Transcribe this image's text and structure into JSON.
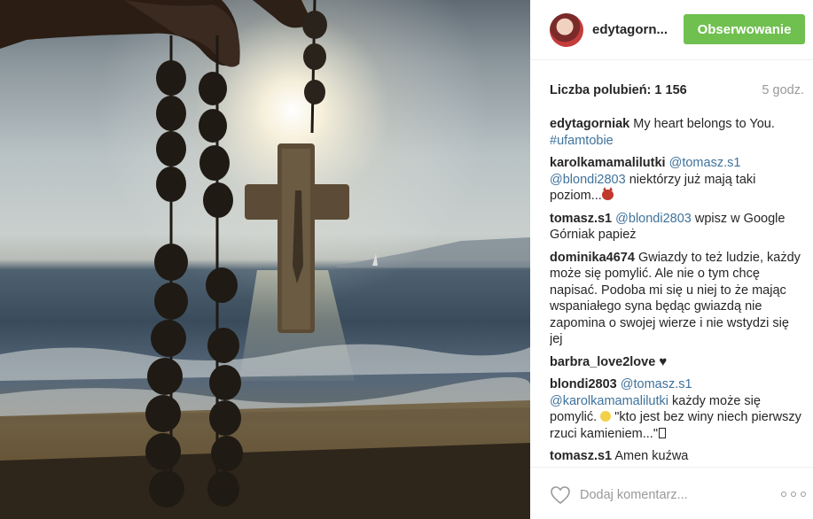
{
  "photo": {
    "description_icon": "rosary-cross-sunset-photo"
  },
  "header": {
    "username": "edytagorn...",
    "follow_label": "Obserwowanie",
    "follow_color": "#70c050"
  },
  "meta": {
    "likes": "Liczba polubień: 1 156",
    "time": "5 godz."
  },
  "caption": {
    "user": "edytagorniak",
    "text": "My heart belongs to You.",
    "hashtag": "#ufamtobie"
  },
  "comments": [
    {
      "user": "karolkamamalilutki",
      "mention1": "@tomasz.s1",
      "mention2": "@blondi2803",
      "text": "niektórzy już mają taki poziom..."
    },
    {
      "user": "tomasz.s1",
      "mention1": "@blondi2803",
      "text": "wpisz w Google Górniak papież"
    },
    {
      "user": "dominika4674",
      "text": "Gwiazdy to też ludzie, każdy może się pomylić. Ale nie o tym chcę napisać. Podoba mi się u niej to że mając wspaniałego syna będąc gwiazdą nie zapomina o swojej wierze i nie wstydzi się jej"
    },
    {
      "user": "barbra_love2love",
      "text": "♥"
    },
    {
      "user": "blondi2803",
      "mention1": "@tomasz.s1",
      "mention2": "@karolkamamalilutki",
      "text1": "każdy może się pomylić.",
      "text2": "\"kto jest bez winy niech pierwszy rzuci kamieniem...\""
    },
    {
      "user": "tomasz.s1",
      "text": "Amen kuźwa"
    }
  ],
  "footer": {
    "comment_placeholder": "Dodaj komentarz..."
  },
  "colors": {
    "link": "#3f729b",
    "muted": "#999999"
  }
}
